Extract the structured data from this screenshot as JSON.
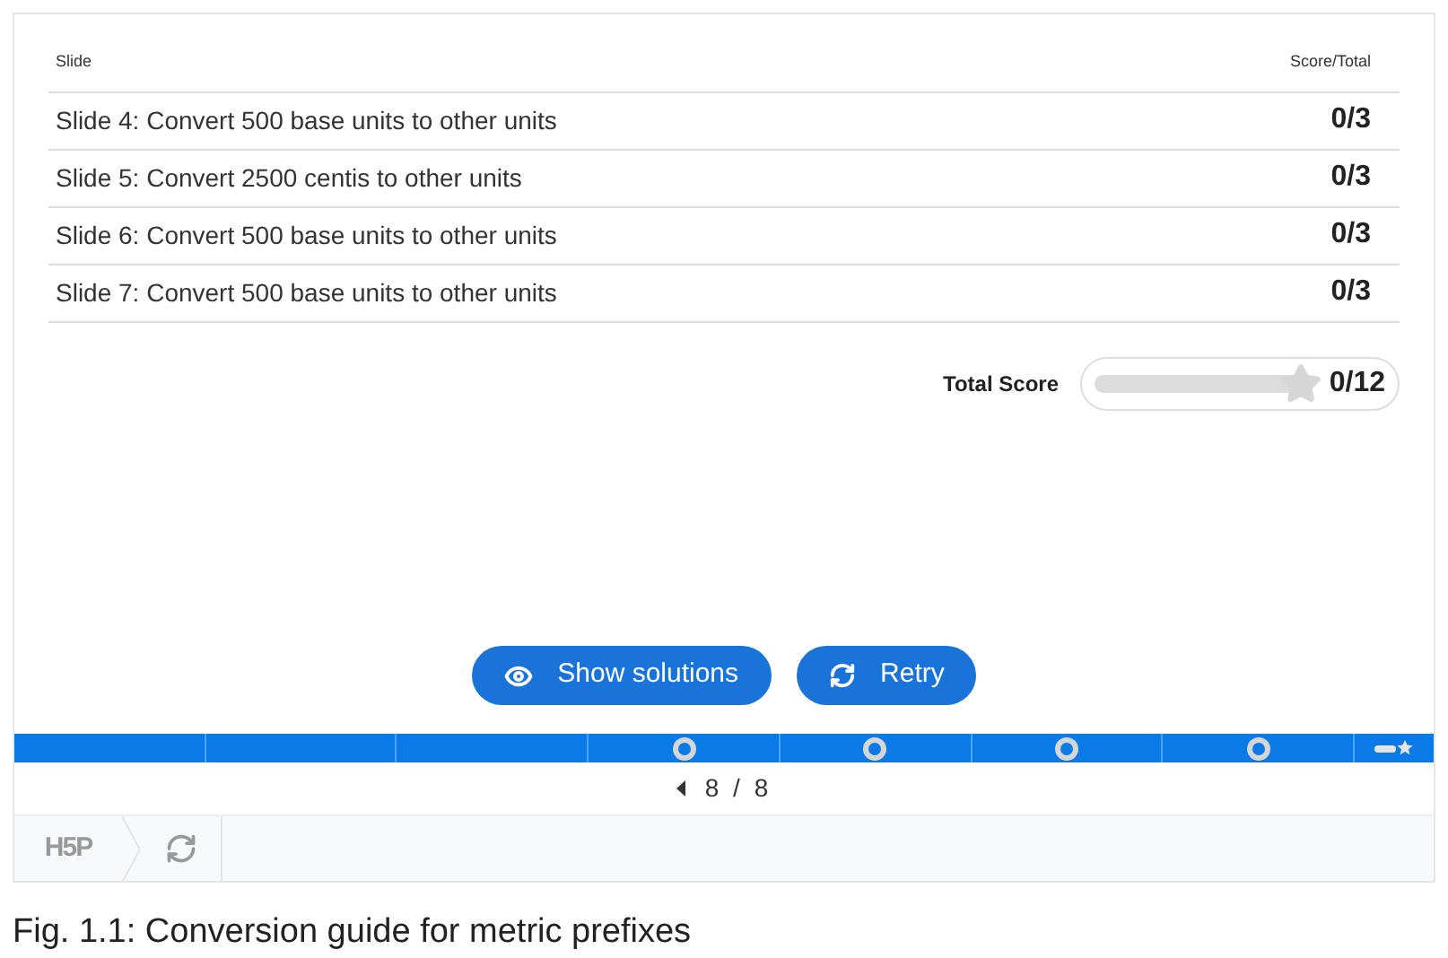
{
  "table": {
    "columns": [
      "Slide",
      "Score/Total"
    ],
    "rows": [
      {
        "slide": "Slide 4: Convert 500 base units to other units",
        "score": "0/3"
      },
      {
        "slide": "Slide 5: Convert 2500 centis to other units",
        "score": "0/3"
      },
      {
        "slide": "Slide 6: Convert 500 base units to other units",
        "score": "0/3"
      },
      {
        "slide": "Slide 7: Convert 500 base units to other units",
        "score": "0/3"
      }
    ]
  },
  "total": {
    "label": "Total Score",
    "level": 0,
    "score": "0/12"
  },
  "buttons": [
    {
      "kind": "solutions",
      "label": "Show solutions"
    },
    {
      "kind": "retry",
      "label": "Retry"
    }
  ],
  "progress": [
    {
      "has_task": false
    },
    {
      "has_task": false
    },
    {
      "has_task": false
    },
    {
      "has_task": true
    },
    {
      "has_task": true
    },
    {
      "has_task": true
    },
    {
      "has_task": true
    }
  ],
  "navigation": {
    "counter": "8 / 8"
  },
  "footer": {
    "logo": "H5P"
  },
  "caption": "Fig. 1.1: Conversion guide for metric prefixes"
}
